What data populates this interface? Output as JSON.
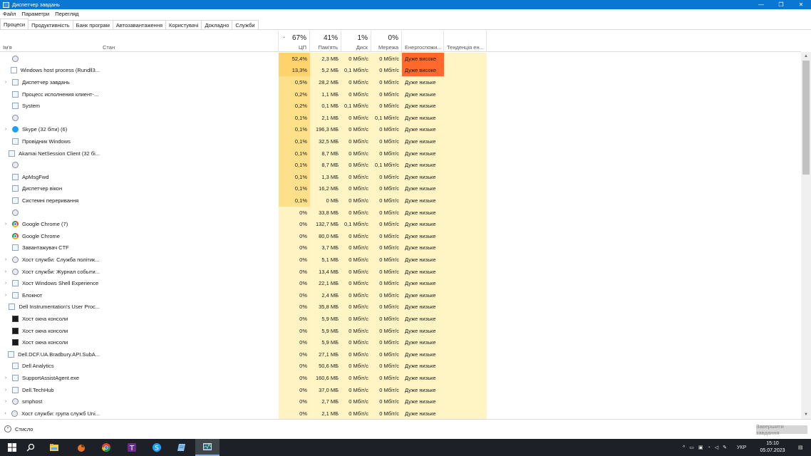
{
  "window": {
    "title": "Диспетчер завдань",
    "controls": [
      "—",
      "❐",
      "✕"
    ]
  },
  "menu": [
    "Файл",
    "Параметри",
    "Перегляд"
  ],
  "tabs": [
    "Процеси",
    "Продуктивність",
    "Банк програм",
    "Автозавантаження",
    "Користувачі",
    "Докладно",
    "Служби"
  ],
  "header": {
    "name": "Ім'я",
    "status": "Стан",
    "cpu_pct": "67%",
    "cpu": "ЦП",
    "mem_pct": "41%",
    "mem": "Пам'ять",
    "disk_pct": "1%",
    "disk": "Диск",
    "net_pct": "0%",
    "net": "Мережа",
    "power": "Енергоспожи...",
    "trend": "Тенденція ен..."
  },
  "rows": [
    {
      "name": "",
      "exp": "",
      "icon": "gear-icon",
      "cpu": "52,4%",
      "mem": "2,3 МБ",
      "disk": "0 Мбіт/с",
      "net": "0 Мбіт/с",
      "power": "Дуже високе",
      "heat": "h"
    },
    {
      "name": "Windows host process (Rundll3...",
      "exp": "",
      "icon": "generic-icon",
      "cpu": "13,3%",
      "mem": "5,2 МБ",
      "disk": "0,1 Мбіт/с",
      "net": "0 Мбіт/с",
      "power": "Дуже високе",
      "heat": "h"
    },
    {
      "name": "Диспетчер завдань",
      "exp": "›",
      "icon": "task-manager-icon",
      "cpu": "0,5%",
      "mem": "28,2 МБ",
      "disk": "0 Мбіт/с",
      "net": "0 Мбіт/с",
      "power": "Дуже низьке",
      "heat": "m"
    },
    {
      "name": "Процесс исполнения клиент-...",
      "exp": "",
      "icon": "window-icon",
      "cpu": "0,2%",
      "mem": "1,1 МБ",
      "disk": "0 Мбіт/с",
      "net": "0 Мбіт/с",
      "power": "Дуже низьке",
      "heat": "m"
    },
    {
      "name": "System",
      "exp": "",
      "icon": "window-icon",
      "cpu": "0,2%",
      "mem": "0,1 МБ",
      "disk": "0,1 Мбіт/с",
      "net": "0 Мбіт/с",
      "power": "Дуже низьке",
      "heat": "m"
    },
    {
      "name": "",
      "exp": "",
      "icon": "gear-icon",
      "cpu": "0,1%",
      "mem": "2,1 МБ",
      "disk": "0 Мбіт/с",
      "net": "0,1 Мбіт/с",
      "power": "Дуже низьке",
      "heat": "m"
    },
    {
      "name": "Skype (32 біти) (6)",
      "exp": "›",
      "icon": "skype-icon",
      "cpu": "0,1%",
      "mem": "196,3 МБ",
      "disk": "0 Мбіт/с",
      "net": "0 Мбіт/с",
      "power": "Дуже низьке",
      "heat": "m"
    },
    {
      "name": "Провідник Windows",
      "exp": "",
      "icon": "folder-icon",
      "cpu": "0,1%",
      "mem": "32,5 МБ",
      "disk": "0 Мбіт/с",
      "net": "0 Мбіт/с",
      "power": "Дуже низьке",
      "heat": "m"
    },
    {
      "name": "Akamai NetSession Client (32 бі...",
      "exp": "",
      "icon": "akamai-icon",
      "cpu": "0,1%",
      "mem": "8,7 МБ",
      "disk": "0 Мбіт/с",
      "net": "0 Мбіт/с",
      "power": "Дуже низьке",
      "heat": "m"
    },
    {
      "name": "",
      "exp": "",
      "icon": "gear-icon",
      "cpu": "0,1%",
      "mem": "8,7 МБ",
      "disk": "0 Мбіт/с",
      "net": "0,1 Мбіт/с",
      "power": "Дуже низьке",
      "heat": "m"
    },
    {
      "name": "ApMsgFwd",
      "exp": "",
      "icon": "window-icon",
      "cpu": "0,1%",
      "mem": "1,3 МБ",
      "disk": "0 Мбіт/с",
      "net": "0 Мбіт/с",
      "power": "Дуже низьке",
      "heat": "m"
    },
    {
      "name": "Диспетчер вікон",
      "exp": "",
      "icon": "window-icon",
      "cpu": "0,1%",
      "mem": "16,2 МБ",
      "disk": "0 Мбіт/с",
      "net": "0 Мбіт/с",
      "power": "Дуже низьке",
      "heat": "m"
    },
    {
      "name": "Системні переривання",
      "exp": "",
      "icon": "window-icon",
      "cpu": "0,1%",
      "mem": "0 МБ",
      "disk": "0 Мбіт/с",
      "net": "0 Мбіт/с",
      "power": "Дуже низьке",
      "heat": "m"
    },
    {
      "name": "",
      "exp": "",
      "icon": "gear-icon",
      "cpu": "0%",
      "mem": "33,8 МБ",
      "disk": "0 Мбіт/с",
      "net": "0 Мбіт/с",
      "power": "Дуже низьке",
      "heat": "l"
    },
    {
      "name": "Google Chrome (7)",
      "exp": "›",
      "icon": "chrome-icon",
      "cpu": "0%",
      "mem": "132,7 МБ",
      "disk": "0,1 Мбіт/с",
      "net": "0 Мбіт/с",
      "power": "Дуже низьке",
      "heat": "l"
    },
    {
      "name": "Google Chrome",
      "exp": "",
      "icon": "chrome-icon",
      "cpu": "0%",
      "mem": "80,0 МБ",
      "disk": "0 Мбіт/с",
      "net": "0 Мбіт/с",
      "power": "Дуже низьке",
      "heat": "l"
    },
    {
      "name": "Завантажувач CTF",
      "exp": "",
      "icon": "pen-icon",
      "cpu": "0%",
      "mem": "3,7 МБ",
      "disk": "0 Мбіт/с",
      "net": "0 Мбіт/с",
      "power": "Дуже низьке",
      "heat": "l"
    },
    {
      "name": "Хост служби: Служба політик...",
      "exp": "›",
      "icon": "gear-icon",
      "cpu": "0%",
      "mem": "5,1 МБ",
      "disk": "0 Мбіт/с",
      "net": "0 Мбіт/с",
      "power": "Дуже низьке",
      "heat": "l"
    },
    {
      "name": "Хост служби: Журнал событи...",
      "exp": "›",
      "icon": "gear-icon",
      "cpu": "0%",
      "mem": "13,4 МБ",
      "disk": "0 Мбіт/с",
      "net": "0 Мбіт/с",
      "power": "Дуже низьке",
      "heat": "l"
    },
    {
      "name": "Хост Windows Shell Experience",
      "exp": "›",
      "icon": "window-icon",
      "cpu": "0%",
      "mem": "22,1 МБ",
      "disk": "0 Мбіт/с",
      "net": "0 Мбіт/с",
      "power": "Дуже низьке",
      "heat": "l"
    },
    {
      "name": "Блокнот",
      "exp": "›",
      "icon": "notepad-icon",
      "cpu": "0%",
      "mem": "2,4 МБ",
      "disk": "0 Мбіт/с",
      "net": "0 Мбіт/с",
      "power": "Дуже низьке",
      "heat": "l"
    },
    {
      "name": "Dell Instrumentation's User Proc...",
      "exp": "",
      "icon": "window-icon",
      "cpu": "0%",
      "mem": "35,8 МБ",
      "disk": "0 Мбіт/с",
      "net": "0 Мбіт/с",
      "power": "Дуже низьке",
      "heat": "l"
    },
    {
      "name": "Хост окна консоли",
      "exp": "",
      "icon": "console-icon",
      "cpu": "0%",
      "mem": "5,9 МБ",
      "disk": "0 Мбіт/с",
      "net": "0 Мбіт/с",
      "power": "Дуже низьке",
      "heat": "l"
    },
    {
      "name": "Хост окна консоли",
      "exp": "",
      "icon": "console-icon",
      "cpu": "0%",
      "mem": "5,9 МБ",
      "disk": "0 Мбіт/с",
      "net": "0 Мбіт/с",
      "power": "Дуже низьке",
      "heat": "l"
    },
    {
      "name": "Хост окна консоли",
      "exp": "",
      "icon": "console-icon",
      "cpu": "0%",
      "mem": "5,9 МБ",
      "disk": "0 Мбіт/с",
      "net": "0 Мбіт/с",
      "power": "Дуже низьке",
      "heat": "l"
    },
    {
      "name": "Dell.DCF.UA.Bradbury.API.SubA...",
      "exp": "",
      "icon": "window-icon",
      "cpu": "0%",
      "mem": "27,1 МБ",
      "disk": "0 Мбіт/с",
      "net": "0 Мбіт/с",
      "power": "Дуже низьке",
      "heat": "l"
    },
    {
      "name": "Dell Analytics",
      "exp": "",
      "icon": "window-icon",
      "cpu": "0%",
      "mem": "50,6 МБ",
      "disk": "0 Мбіт/с",
      "net": "0 Мбіт/с",
      "power": "Дуже низьке",
      "heat": "l"
    },
    {
      "name": "SupportAssistAgent.exe",
      "exp": "›",
      "icon": "window-icon",
      "cpu": "0%",
      "mem": "160,6 МБ",
      "disk": "0 Мбіт/с",
      "net": "0 Мбіт/с",
      "power": "Дуже низьке",
      "heat": "l"
    },
    {
      "name": "Dell.TechHub",
      "exp": "›",
      "icon": "window-icon",
      "cpu": "0%",
      "mem": "37,0 МБ",
      "disk": "0 Мбіт/с",
      "net": "0 Мбіт/с",
      "power": "Дуже низьке",
      "heat": "l"
    },
    {
      "name": "smphost",
      "exp": "›",
      "icon": "gear-icon",
      "cpu": "0%",
      "mem": "2,7 МБ",
      "disk": "0 Мбіт/с",
      "net": "0 Мбіт/с",
      "power": "Дуже низьке",
      "heat": "l"
    },
    {
      "name": "Хост служби: група служб Uni...",
      "exp": "›",
      "icon": "gear-icon",
      "cpu": "0%",
      "mem": "2,1 МБ",
      "disk": "0 Мбіт/с",
      "net": "0 Мбіт/с",
      "power": "Дуже низьке",
      "heat": "l"
    }
  ],
  "footer": {
    "less_label": "Стисло",
    "end_task": "Завершити завдання"
  },
  "taskbar": {
    "apps": [
      "start-icon",
      "search-icon",
      "file-explorer-icon",
      "game-icon",
      "chrome-icon",
      "t-app-icon",
      "skype-icon",
      "notepad-icon",
      "task-manager-icon"
    ],
    "lang": "УКР",
    "time": "15:10",
    "date": "05.07.2023"
  },
  "colors": {
    "titlebar": "#0a78d2",
    "cpu_high": "#ffd36b",
    "column_tint": "#fff4c4",
    "power_very_high": "#ff6a2c"
  }
}
